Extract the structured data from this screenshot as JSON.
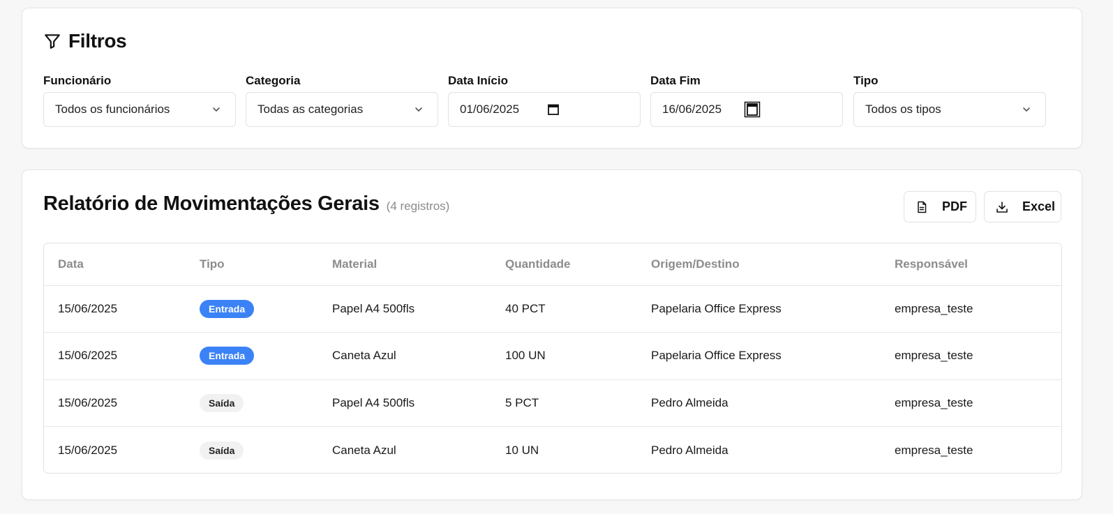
{
  "filters": {
    "title": "Filtros",
    "funcionario": {
      "label": "Funcionário",
      "value": "Todos os funcionários"
    },
    "categoria": {
      "label": "Categoria",
      "value": "Todas as categorias"
    },
    "data_inicio": {
      "label": "Data Início",
      "value": "01/06/2025"
    },
    "data_fim": {
      "label": "Data Fim",
      "value": "16/06/2025"
    },
    "tipo": {
      "label": "Tipo",
      "value": "Todos os tipos"
    }
  },
  "report": {
    "title": "Relatório de Movimentações Gerais",
    "count": "(4 registros)",
    "pdf_label": "PDF",
    "excel_label": "Excel",
    "columns": [
      "Data",
      "Tipo",
      "Material",
      "Quantidade",
      "Origem/Destino",
      "Responsável"
    ],
    "rows": [
      {
        "data": "15/06/2025",
        "tipo": "Entrada",
        "material": "Papel A4 500fls",
        "quantidade": "40 PCT",
        "origem": "Papelaria Office Express",
        "responsavel": "empresa_teste"
      },
      {
        "data": "15/06/2025",
        "tipo": "Entrada",
        "material": "Caneta Azul",
        "quantidade": "100 UN",
        "origem": "Papelaria Office Express",
        "responsavel": "empresa_teste"
      },
      {
        "data": "15/06/2025",
        "tipo": "Saída",
        "material": "Papel A4 500fls",
        "quantidade": "5 PCT",
        "origem": "Pedro Almeida",
        "responsavel": "empresa_teste"
      },
      {
        "data": "15/06/2025",
        "tipo": "Saída",
        "material": "Caneta Azul",
        "quantidade": "10 UN",
        "origem": "Pedro Almeida",
        "responsavel": "empresa_teste"
      }
    ]
  },
  "colors": {
    "entrada_badge": "#3b82f6",
    "saida_badge": "#f1f1f1"
  },
  "icons": [
    "filter-icon",
    "chevron-down-icon",
    "calendar-icon",
    "file-text-icon",
    "download-icon"
  ]
}
